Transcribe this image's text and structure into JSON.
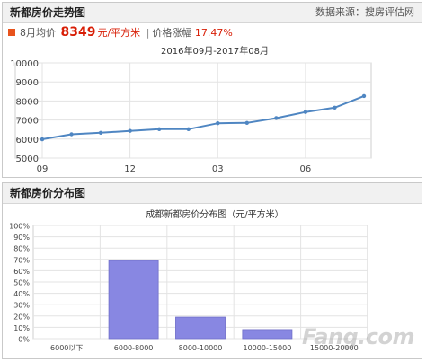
{
  "trend": {
    "header": "新都房价走势图",
    "source": "数据来源：搜房评估网",
    "stats": {
      "month_label": "8月均价",
      "price": "8349",
      "unit": "元/平方米",
      "separator": "|",
      "rise_label": "价格涨幅",
      "rise_value": "17.47%"
    }
  },
  "distribution": {
    "header": "新都房价分布图",
    "watermark": "Fang.com"
  },
  "colors": {
    "accent": "#e8531c",
    "price_red": "#d81e06",
    "line": "#4f86c2",
    "bar": "#8887e2",
    "bar_border": "#6f6ec9"
  },
  "chart_data": [
    {
      "type": "line",
      "title": "2016年09月-2017年08月",
      "xlabel": "",
      "ylabel": "",
      "x_values": [
        "2016-09",
        "2016-10",
        "2016-11",
        "2016-12",
        "2017-01",
        "2017-02",
        "2017-03",
        "2017-04",
        "2017-05",
        "2017-06",
        "2017-07",
        "2017-08"
      ],
      "x_tick_labels": [
        "09",
        "12",
        "03",
        "06"
      ],
      "x_tick_indices": [
        0,
        3,
        6,
        9
      ],
      "y_ticks": [
        5000,
        6000,
        7000,
        8000,
        9000,
        10000
      ],
      "ylim": [
        5000,
        10000
      ],
      "grid": true,
      "series": [
        {
          "values": [
            5990,
            6250,
            6330,
            6430,
            6520,
            6520,
            6830,
            6850,
            7100,
            7420,
            7650,
            8260
          ]
        }
      ]
    },
    {
      "type": "bar",
      "title": "成都新都房价分布图（元/平方米）",
      "xlabel": "",
      "ylabel": "",
      "categories": [
        "6000以下",
        "6000-8000",
        "8000-10000",
        "10000-15000",
        "15000-20000"
      ],
      "y_ticks": [
        "0%",
        "10%",
        "20%",
        "30%",
        "40%",
        "50%",
        "60%",
        "70%",
        "80%",
        "90%",
        "100%"
      ],
      "ylim": [
        0,
        100
      ],
      "grid": true,
      "series": [
        {
          "values": [
            0,
            69,
            19,
            8,
            0
          ]
        }
      ]
    }
  ]
}
